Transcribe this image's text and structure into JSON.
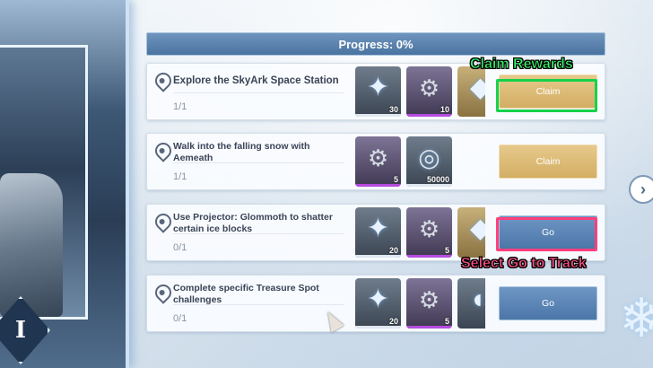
{
  "progress": {
    "label": "Progress: 0%",
    "value": 0
  },
  "left_card": {
    "emblem": "I"
  },
  "quests": [
    {
      "title": "Explore the SkyArk Space Station",
      "count": "1/1",
      "rewards": [
        {
          "icon": "star-crystal-icon",
          "qty": "30",
          "style": "silver"
        },
        {
          "icon": "gear-device-icon",
          "qty": "10",
          "style": "purple"
        },
        {
          "icon": "gold-item-icon",
          "qty": "",
          "style": "gold"
        }
      ],
      "button": {
        "label": "Claim",
        "kind": "claim"
      }
    },
    {
      "title": "Walk into the falling snow with Aemeath",
      "count": "1/1",
      "rewards": [
        {
          "icon": "gear-device-icon",
          "qty": "5",
          "style": "purple"
        },
        {
          "icon": "coin-icon",
          "qty": "50000",
          "style": "silver"
        }
      ],
      "button": {
        "label": "Claim",
        "kind": "claim"
      }
    },
    {
      "title": "Use Projector: Glommoth to shatter certain ice blocks",
      "count": "0/1",
      "rewards": [
        {
          "icon": "star-crystal-icon",
          "qty": "20",
          "style": "silver"
        },
        {
          "icon": "gear-device-icon",
          "qty": "5",
          "style": "purple"
        },
        {
          "icon": "gold-item-icon",
          "qty": "",
          "style": "gold"
        }
      ],
      "button": {
        "label": "Go",
        "kind": "go"
      }
    },
    {
      "title": "Complete specific Treasure Spot challenges",
      "count": "0/1",
      "rewards": [
        {
          "icon": "star-crystal-icon",
          "qty": "20",
          "style": "silver"
        },
        {
          "icon": "gear-device-icon",
          "qty": "5",
          "style": "purple"
        },
        {
          "icon": "dark-item-icon",
          "qty": "",
          "style": "silver"
        }
      ],
      "button": {
        "label": "Go",
        "kind": "go"
      }
    }
  ],
  "annotations": {
    "claim_callout": "Claim Rewards",
    "go_callout": "Select Go to Track",
    "claim_color": "#16d24a",
    "go_color": "#ff3f7e"
  },
  "next_arrow": "›"
}
